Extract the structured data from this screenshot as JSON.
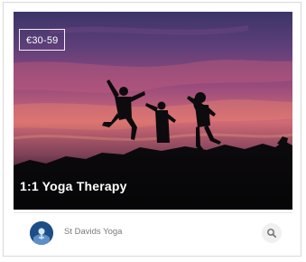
{
  "card": {
    "price": "€30-59",
    "title": "1:1 Yoga Therapy",
    "provider": "St Davids Yoga",
    "image": "silhouettes-jumping-sunset",
    "icons": {
      "avatar": "provider-logo",
      "action": "search-icon"
    }
  }
}
